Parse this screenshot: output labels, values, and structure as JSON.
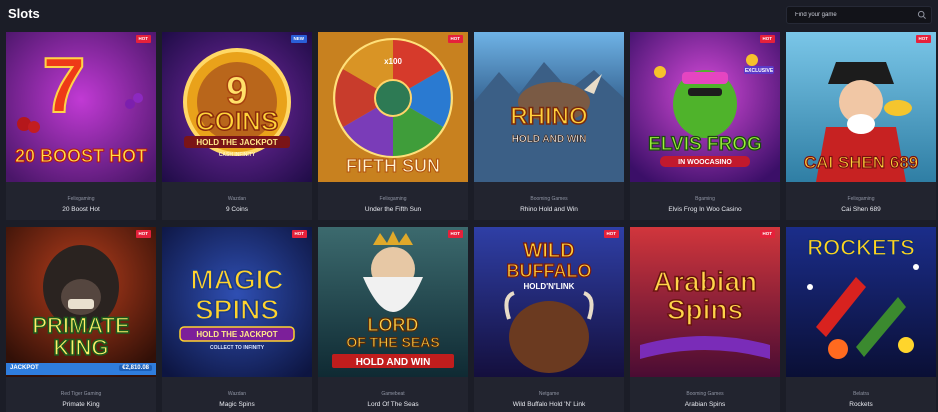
{
  "header": {
    "title": "Slots",
    "search_placeholder": "Find your game"
  },
  "games": [
    {
      "name": "20 Boost Hot",
      "provider": "Felixgaming",
      "badge": "HOT",
      "art_lines": [
        "7",
        "20 BOOST HOT"
      ],
      "accent": "#e0331f"
    },
    {
      "name": "9 Coins",
      "provider": "Wazdan",
      "badge": "NEW",
      "art_lines": [
        "9",
        "COINS",
        "HOLD THE JACKPOT",
        "CASH INFINITY"
      ],
      "accent": "#f4b31b"
    },
    {
      "name": "Under the Fifth Sun",
      "provider": "Felixgaming",
      "badge": "HOT",
      "art_lines": [
        "FIFTH SUN",
        "x100"
      ],
      "accent": "#e98a14"
    },
    {
      "name": "Rhino Hold and Win",
      "provider": "Booming Games",
      "badge": "",
      "art_lines": [
        "RHINO",
        "HOLD AND WIN"
      ],
      "accent": "#f2a623"
    },
    {
      "name": "Elvis Frog In Woo Casino",
      "provider": "Bgaming",
      "badge": "HOT",
      "art_lines": [
        "ELVIS FROG",
        "IN WOOCASINO",
        "EXCLUSIVE"
      ],
      "accent": "#7dd12c"
    },
    {
      "name": "Cai Shen 689",
      "provider": "Felixgaming",
      "badge": "HOT",
      "art_lines": [
        "CAI SHEN 689"
      ],
      "accent": "#e4b12a"
    },
    {
      "name": "Primate King",
      "provider": "Red Tiger Gaming",
      "badge": "HOT",
      "art_lines": [
        "PRIMATE",
        "KING"
      ],
      "accent": "#e8c21f"
    },
    {
      "name": "Magic Spins",
      "provider": "Wazdan",
      "badge": "HOT",
      "art_lines": [
        "MAGIC",
        "SPINS",
        "HOLD THE JACKPOT",
        "COLLECT TO INFINITY"
      ],
      "accent": "#f5c21b"
    },
    {
      "name": "Lord Of The Seas",
      "provider": "Gamebeat",
      "badge": "HOT",
      "art_lines": [
        "LORD",
        "OF THE SEAS",
        "HOLD AND WIN"
      ],
      "accent": "#f0b625"
    },
    {
      "name": "Wild Buffalo Hold 'N' Link",
      "provider": "Netgame",
      "badge": "HOT",
      "art_lines": [
        "WILD",
        "BUFFALO",
        "HOLD'N'LINK"
      ],
      "accent": "#e27122"
    },
    {
      "name": "Arabian Spins",
      "provider": "Booming Games",
      "badge": "HOT",
      "art_lines": [
        "Arabian",
        "Spins"
      ],
      "accent": "#f1a81e"
    },
    {
      "name": "Rockets",
      "provider": "Belatra",
      "badge": "",
      "art_lines": [
        "ROCKETS"
      ],
      "accent": "#f4c71a"
    }
  ],
  "jackpot": {
    "label": "JACKPOT",
    "amount": "€2,810.08"
  }
}
